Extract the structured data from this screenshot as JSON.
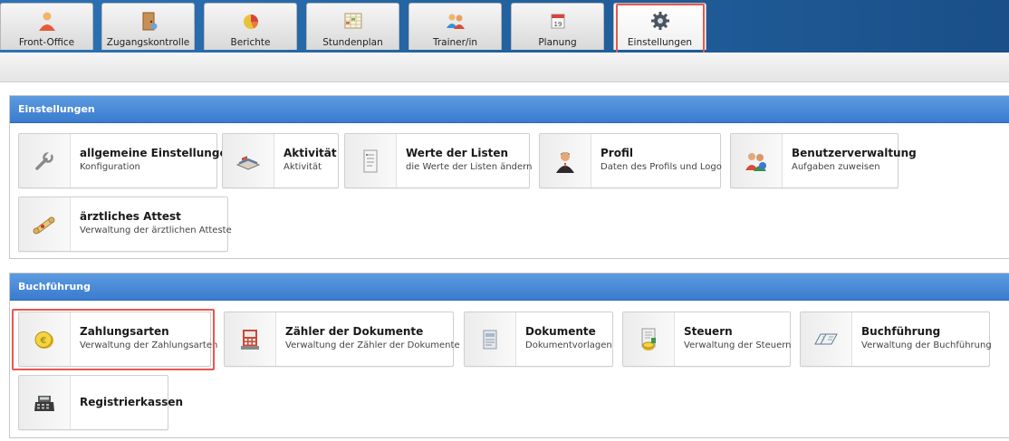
{
  "topnav": {
    "tabs": [
      {
        "label": "Front-Office",
        "icon": "person-icon"
      },
      {
        "label": "Zugangskontrolle",
        "icon": "door-icon"
      },
      {
        "label": "Berichte",
        "icon": "pie-chart-icon"
      },
      {
        "label": "Stundenplan",
        "icon": "timetable-icon"
      },
      {
        "label": "Trainer/in",
        "icon": "trainers-icon"
      },
      {
        "label": "Planung",
        "icon": "calendar-icon"
      },
      {
        "label": "Einstellungen",
        "icon": "gear-icon",
        "active": true
      }
    ]
  },
  "sections": [
    {
      "title": "Einstellungen",
      "tiles": [
        {
          "title": "allgemeine Einstellungen",
          "subtitle": "Konfiguration",
          "icon": "wrench-icon"
        },
        {
          "title": "Aktivität",
          "subtitle": "Aktivität",
          "icon": "book-icon"
        },
        {
          "title": "Werte der Listen",
          "subtitle": "die Werte der Listen ändern",
          "icon": "list-icon"
        },
        {
          "title": "Profil",
          "subtitle": "Daten des Profils und Logo",
          "icon": "profile-icon"
        },
        {
          "title": "Benutzerverwaltung",
          "subtitle": "Aufgaben zuweisen",
          "icon": "users-icon"
        },
        {
          "title": "ärztliches Attest",
          "subtitle": "Verwaltung der ärztlichen Atteste",
          "icon": "scroll-icon"
        }
      ]
    },
    {
      "title": "Buchführung",
      "tiles": [
        {
          "title": "Zahlungsarten",
          "subtitle": "Verwaltung der Zahlungsarten",
          "icon": "coin-icon"
        },
        {
          "title": "Zähler der Dokumente",
          "subtitle": "Verwaltung der Zähler der Dokumente",
          "icon": "counter-icon"
        },
        {
          "title": "Dokumente",
          "subtitle": "Dokumentvorlagen",
          "icon": "document-icon"
        },
        {
          "title": "Steuern",
          "subtitle": "Verwaltung der Steuern",
          "icon": "tax-icon"
        },
        {
          "title": "Buchführung",
          "subtitle": "Verwaltung der Buchführung",
          "icon": "ledger-icon"
        },
        {
          "title": "Registrierkassen",
          "subtitle": "",
          "icon": "cash-register-icon"
        }
      ]
    }
  ],
  "colors": {
    "nav_blue": "#22609e",
    "section_header": "#4a8bd8",
    "highlight": "#e8574f"
  }
}
